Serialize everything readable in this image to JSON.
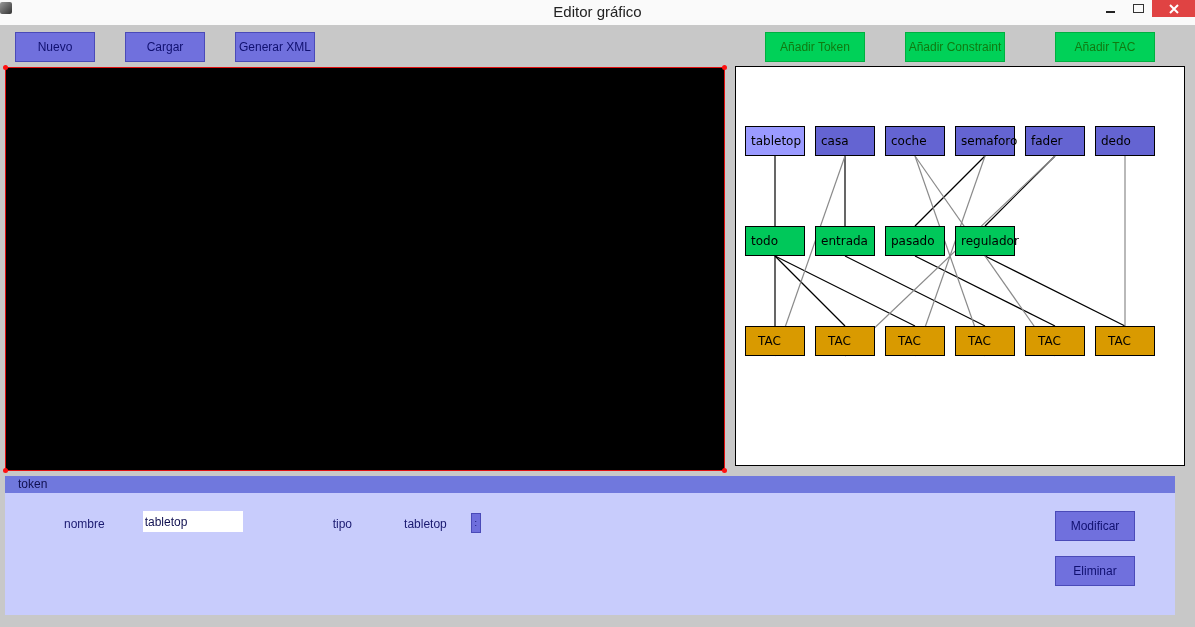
{
  "window": {
    "title": "Editor gráfico"
  },
  "toolbar_left": [
    "Nuevo",
    "Cargar",
    "Generar XML"
  ],
  "toolbar_right": [
    "Añadir Token",
    "Añadir Constraint",
    "Añadir TAC"
  ],
  "diagram": {
    "tokens": [
      {
        "label": "tabletop",
        "selected": true
      },
      {
        "label": "casa",
        "selected": false
      },
      {
        "label": "coche",
        "selected": false
      },
      {
        "label": "semaforo",
        "selected": false
      },
      {
        "label": "fader",
        "selected": false
      },
      {
        "label": "dedo",
        "selected": false
      }
    ],
    "constraints": [
      {
        "label": "todo"
      },
      {
        "label": "entrada"
      },
      {
        "label": "pasado"
      },
      {
        "label": "regulador"
      }
    ],
    "tacs": [
      {
        "label": "TAC"
      },
      {
        "label": "TAC"
      },
      {
        "label": "TAC"
      },
      {
        "label": "TAC"
      },
      {
        "label": "TAC"
      },
      {
        "label": "TAC"
      }
    ]
  },
  "properties": {
    "header": "token",
    "name_label": "nombre",
    "name_value": "tabletop",
    "type_label": "tipo",
    "type_value": "tabletop",
    "type_button": ":",
    "buttons": [
      "Modificar",
      "Eliminar"
    ]
  }
}
